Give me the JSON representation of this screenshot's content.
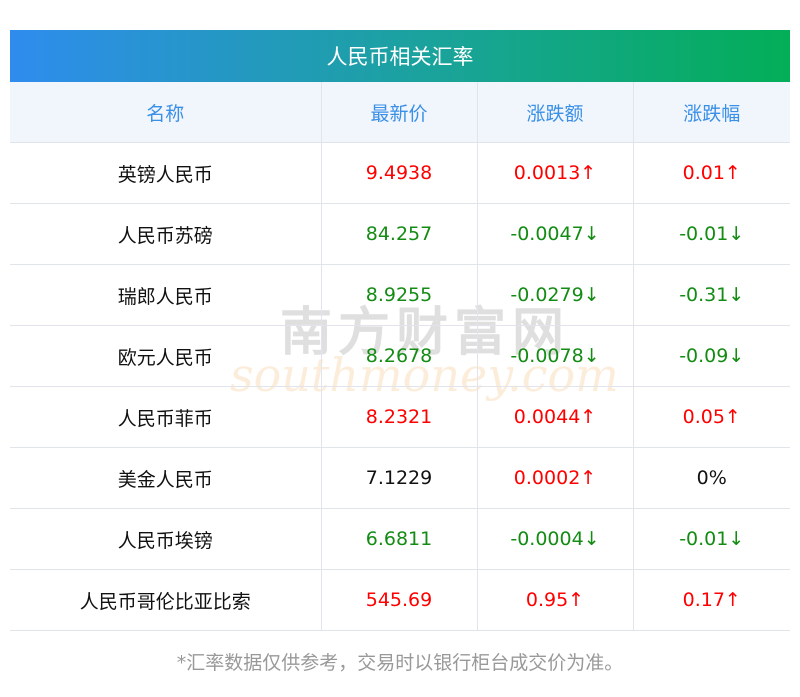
{
  "title": "人民币相关汇率",
  "columns": [
    "名称",
    "最新价",
    "涨跌额",
    "涨跌幅"
  ],
  "rows": [
    {
      "name": "英镑人民币",
      "price": "9.4938",
      "change": "0.0013↑",
      "pct": "0.01↑",
      "trend": "up"
    },
    {
      "name": "人民币苏磅",
      "price": "84.257",
      "change": "-0.0047↓",
      "pct": "-0.01↓",
      "trend": "down"
    },
    {
      "name": "瑞郎人民币",
      "price": "8.9255",
      "change": "-0.0279↓",
      "pct": "-0.31↓",
      "trend": "down"
    },
    {
      "name": "欧元人民币",
      "price": "8.2678",
      "change": "-0.0078↓",
      "pct": "-0.09↓",
      "trend": "down"
    },
    {
      "name": "人民币菲币",
      "price": "8.2321",
      "change": "0.0044↑",
      "pct": "0.05↑",
      "trend": "up"
    },
    {
      "name": "美金人民币",
      "price": "7.1229",
      "change": "0.0002↑",
      "pct": "0%",
      "trend": "up",
      "pct_trend": "flat",
      "price_trend": "flat"
    },
    {
      "name": "人民币埃镑",
      "price": "6.6811",
      "change": "-0.0004↓",
      "pct": "-0.01↓",
      "trend": "down"
    },
    {
      "name": "人民币哥伦比亚比索",
      "price": "545.69",
      "change": "0.95↑",
      "pct": "0.17↑",
      "trend": "up"
    }
  ],
  "note": "*汇率数据仅供参考，交易时以银行柜台成交价为准。",
  "watermark": {
    "cn": "南方财富网",
    "en": "southmoney.com"
  },
  "colors": {
    "up": "#ff0000",
    "down": "#148c14",
    "header_text": "#3a8fe6"
  }
}
